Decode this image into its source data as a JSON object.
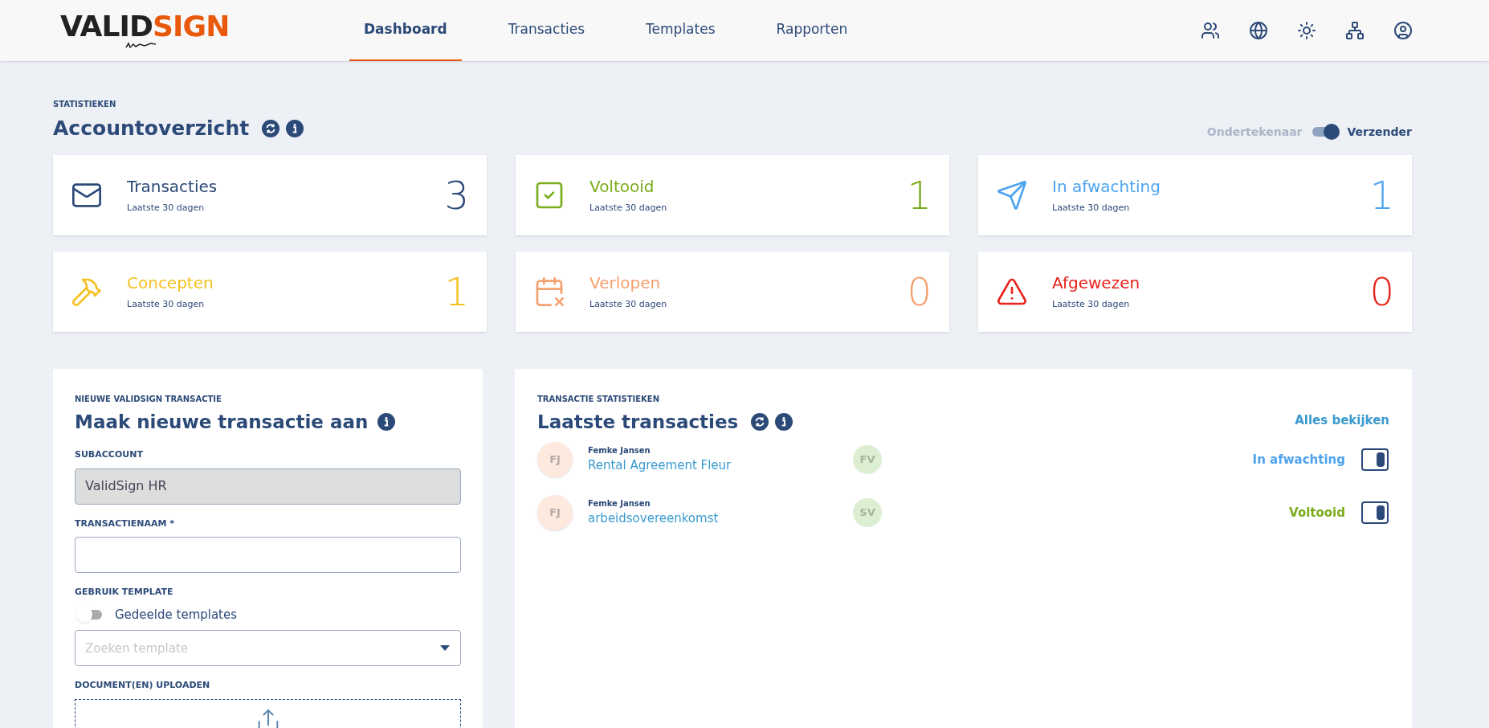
{
  "logo": {
    "part_1": "VALID",
    "part_2": "SIGN"
  },
  "nav": [
    {
      "label": "Dashboard",
      "selected": true
    },
    {
      "label": "Transacties",
      "selected": false
    },
    {
      "label": "Templates",
      "selected": false
    },
    {
      "label": "Rapporten",
      "selected": false
    }
  ],
  "header_icons": [
    {
      "kind": "users"
    },
    {
      "kind": "globe"
    },
    {
      "kind": "sun"
    },
    {
      "kind": "network"
    },
    {
      "kind": "account"
    }
  ],
  "overview": {
    "eyebrow": "STATISTIEKEN",
    "title": "Accountoverzicht",
    "toggle": {
      "off_label": "Ondertekenaar",
      "on_label": "Verzender",
      "on": true
    }
  },
  "stats": [
    {
      "kind": "mail",
      "title": "Transacties",
      "subtitle": "Laatste 30 dagen",
      "count": "3",
      "color": "#2c4a78"
    },
    {
      "kind": "check",
      "title": "Voltooid",
      "subtitle": "Laatste 30 dagen",
      "count": "1",
      "color": "#7aac1c"
    },
    {
      "kind": "send",
      "title": "In afwachting",
      "subtitle": "Laatste 30 dagen",
      "count": "1",
      "color": "#4da3f0"
    },
    {
      "kind": "hammer",
      "title": "Concepten",
      "subtitle": "Laatste 30 dagen",
      "count": "1",
      "color": "#f5c020"
    },
    {
      "kind": "calendar",
      "title": "Verlopen",
      "subtitle": "Laatste 30 dagen",
      "count": "0",
      "color": "#f5a070"
    },
    {
      "kind": "warning",
      "title": "Afgewezen",
      "subtitle": "Laatste 30 dagen",
      "count": "0",
      "color": "#e8221c"
    }
  ],
  "new_transaction": {
    "eyebrow": "NIEUWE VALIDSIGN TRANSACTIE",
    "title": "Maak nieuwe transactie aan",
    "subaccount": {
      "label": "SUBACCOUNT",
      "value": "ValidSign HR",
      "disabled": true
    },
    "name": {
      "label": "TRANSACTIENAAM *"
    },
    "template": {
      "label": "GEBRUIK TEMPLATE",
      "switch_label": "Gedeelde templates",
      "on": false,
      "placeholder": "Zoeken template"
    },
    "upload": {
      "label": "DOCUMENT(EN) UPLOADEN"
    }
  },
  "latest": {
    "eyebrow": "TRANSACTIE STATISTIEKEN",
    "title": "Laatste transacties",
    "link": "Alles bekijken",
    "rows": [
      {
        "sender_initials": "FJ",
        "sender": "Femke Jansen",
        "name": "Rental Agreement Fleur",
        "signer_initials": "FV",
        "status": "In afwachting",
        "color": "#4da3f0"
      },
      {
        "sender_initials": "FJ",
        "sender": "Femke Jansen",
        "name": "arbeidsovereenkomst",
        "signer_initials": "SV",
        "status": "Voltooid",
        "color": "#7aac1c"
      }
    ]
  }
}
